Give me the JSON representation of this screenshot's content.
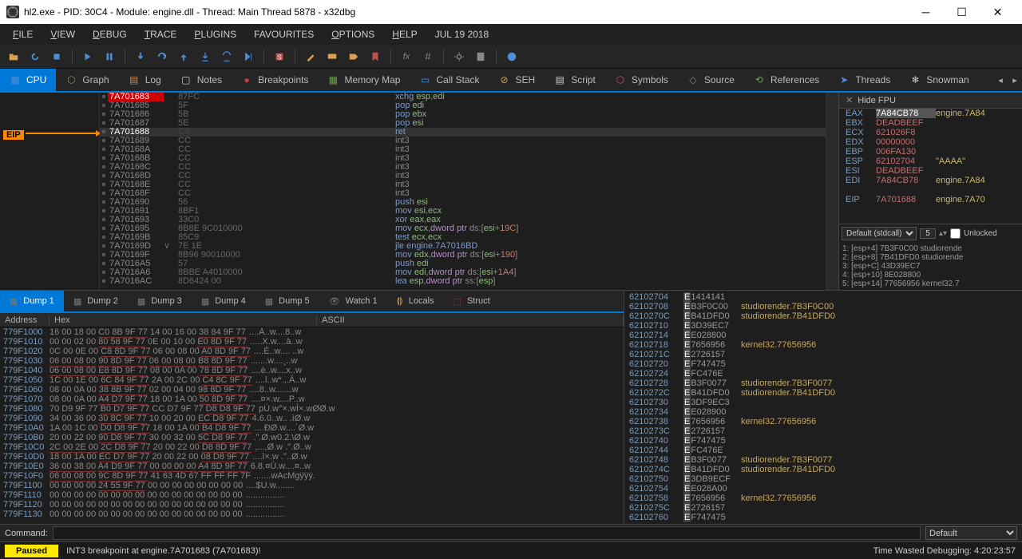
{
  "window": {
    "title": "hl2.exe - PID: 30C4 - Module: engine.dll - Thread: Main Thread 5878 - x32dbg"
  },
  "menu": [
    "FILE",
    "VIEW",
    "DEBUG",
    "TRACE",
    "PLUGINS",
    "FAVOURITES",
    "OPTIONS",
    "HELP",
    "JUL 19 2018"
  ],
  "menu_ul": [
    "F",
    "V",
    "D",
    "T",
    "P",
    "",
    "O",
    "H",
    ""
  ],
  "tabs": [
    "CPU",
    "Graph",
    "Log",
    "Notes",
    "Breakpoints",
    "Memory Map",
    "Call Stack",
    "SEH",
    "Script",
    "Symbols",
    "Source",
    "References",
    "Threads",
    "Snowman"
  ],
  "tab_icons": [
    "cpu",
    "graph",
    "log",
    "notes",
    "bp",
    "mem",
    "stack",
    "seh",
    "script",
    "sym",
    "src",
    "ref",
    "thr",
    "snow"
  ],
  "active_tab": 0,
  "disasm": [
    {
      "dot": "●",
      "addr": "7A701683",
      "hl": true,
      "bytes": "87FC",
      "asm": "<span class=mn>xchg</span> <span class=reg>esp</span>,<span class=reg>edi</span>"
    },
    {
      "dot": "●",
      "addr": "7A701685",
      "bytes": "5F",
      "asm": "<span class=mn>pop</span> <span class=reg>edi</span>"
    },
    {
      "dot": "●",
      "addr": "7A701686",
      "bytes": "5B",
      "asm": "<span class=mn>pop</span> <span class=reg>ebx</span>"
    },
    {
      "dot": "●",
      "addr": "7A701687",
      "bytes": "5E",
      "asm": "<span class=mn>pop</span> <span class=reg>esi</span>"
    },
    {
      "dot": "●",
      "addr": "7A701688",
      "cur": true,
      "bytes": "C3",
      "asm": "<span class=mn>ret</span>"
    },
    {
      "dot": "●",
      "addr": "7A701689",
      "bytes": "CC",
      "asm": "int3"
    },
    {
      "dot": "●",
      "addr": "7A70168A",
      "bytes": "CC",
      "asm": "int3"
    },
    {
      "dot": "●",
      "addr": "7A70168B",
      "bytes": "CC",
      "asm": "int3"
    },
    {
      "dot": "●",
      "addr": "7A70168C",
      "bytes": "CC",
      "asm": "int3"
    },
    {
      "dot": "●",
      "addr": "7A70168D",
      "bytes": "CC",
      "asm": "int3"
    },
    {
      "dot": "●",
      "addr": "7A70168E",
      "bytes": "CC",
      "asm": "int3"
    },
    {
      "dot": "●",
      "addr": "7A70168F",
      "bytes": "CC",
      "asm": "int3"
    },
    {
      "dot": "●",
      "addr": "7A701690",
      "bytes": "56",
      "asm": "<span class=mn>push</span> <span class=reg>esi</span>"
    },
    {
      "dot": "●",
      "addr": "7A701691",
      "bytes": "8BF1",
      "asm": "<span class=mn>mov</span> <span class=reg>esi</span>,<span class=reg>ecx</span>"
    },
    {
      "dot": "●",
      "addr": "7A701693",
      "bytes": "33C0",
      "asm": "<span class=mn>xor</span> <span class=reg>eax</span>,<span class=reg>eax</span>"
    },
    {
      "dot": "●",
      "addr": "7A701695",
      "bytes": "8B8E 9C010000",
      "asm": "<span class=mn>mov</span> <span class=reg>ecx</span>,<span class=kw>dword ptr</span> ds:[<span class=reg>esi</span>+<span class=num>19C</span>]"
    },
    {
      "dot": "●",
      "addr": "7A70169B",
      "bytes": "85C9",
      "asm": "<span class=mn>test</span> <span class=reg>ecx</span>,<span class=reg>ecx</span>"
    },
    {
      "dot": "●",
      "addr": "7A70169D",
      "jmp": "∨",
      "bytes": "7E 1E",
      "asm": "<span class=mn>jle</span> <span class=lbl>engine.7A7016BD</span>"
    },
    {
      "dot": "●",
      "addr": "7A70169F",
      "bytes": "8B96 90010000",
      "asm": "<span class=mn>mov</span> <span class=reg>edx</span>,<span class=kw>dword ptr</span> ds:[<span class=reg>esi</span>+<span class=num>190</span>]"
    },
    {
      "dot": "●",
      "addr": "7A7016A5",
      "bytes": "57",
      "asm": "<span class=mn>push</span> <span class=reg>edi</span>"
    },
    {
      "dot": "●",
      "addr": "7A7016A6",
      "bytes": "8BBE A4010000",
      "asm": "<span class=mn>mov</span> <span class=reg>edi</span>,<span class=kw>dword ptr</span> ds:[<span class=reg>esi</span>+<span class=num>1A4</span>]"
    },
    {
      "dot": "●",
      "addr": "7A7016AC",
      "bytes": "8D6424 00",
      "asm": "<span class=mn>lea</span> <span class=reg>esp</span>,<span class=kw>dword ptr</span> ss:[<span class=reg>esp</span>]"
    }
  ],
  "eip_marker": "EIP",
  "registers": {
    "title": "Hide FPU",
    "rows": [
      {
        "n": "EAX",
        "v": "7A84CB78",
        "sel": true,
        "c": "engine.7A84"
      },
      {
        "n": "EBX",
        "v": "DEADBEEF",
        "c": ""
      },
      {
        "n": "ECX",
        "v": "621026F8",
        "c": ""
      },
      {
        "n": "EDX",
        "v": "00000000",
        "c": ""
      },
      {
        "n": "EBP",
        "v": "006FA130",
        "c": ""
      },
      {
        "n": "ESP",
        "v": "62102704",
        "c": "\"AAAA\""
      },
      {
        "n": "ESI",
        "v": "DEADBEEF",
        "c": ""
      },
      {
        "n": "EDI",
        "v": "7A84CB78",
        "c": "engine.7A84"
      },
      {
        "n": "",
        "v": "",
        "c": ""
      },
      {
        "n": "EIP",
        "v": "7A701688",
        "c": "engine.7A70"
      }
    ],
    "calling_conv": "Default (stdcall)",
    "spin": "5",
    "unlocked": "Unlocked",
    "stackargs": [
      "1: [esp+4] 7B3F0C00 studiorende",
      "2: [esp+8] 7B41DFD0 studiorende",
      "3: [esp+C] 43D39EC7",
      "4: [esp+10] 8E028800",
      "5: [esp+14] 77656956 kernel32.7"
    ]
  },
  "dump_tabs": [
    "Dump 1",
    "Dump 2",
    "Dump 3",
    "Dump 4",
    "Dump 5",
    "Watch 1",
    "Locals",
    "Struct"
  ],
  "active_dump": 0,
  "dump_headers": [
    "Address",
    "Hex",
    "ASCII"
  ],
  "dump": [
    {
      "a": "779F1000",
      "h": "16 00 18 00 <span class=grp>C0 8B 9F 77</span> 14 00 16 00 <span class=grp>38 84 9F 77</span>",
      "s": "....À..w....8..w"
    },
    {
      "a": "779F1010",
      "h": "00 00 02 00 <span class=grp>80 58 9F 77</span> 0E 00 10 00 <span class=grp>E0 8D 9F 77</span>",
      "s": ".....X.w....à..w"
    },
    {
      "a": "779F1020",
      "h": "0C 00 0E 00 <span class=grp>C8 8D 9F 77</span> 06 00 08 00 <span class=grp>A0 8D 9F 77</span>",
      "s": "....È..w.... ..w"
    },
    {
      "a": "779F1030",
      "h": "<span class=grp>06 00 08 00</span> <span class=grp>90 8D 9F 77</span> <span class=grp>06 00 08 00</span> <span class=grp>B8 8D 9F 77</span>",
      "s": ".......w....¸..w"
    },
    {
      "a": "779F1040",
      "h": "<span class=grp>06 00 08 00</span> <span class=grp>E8 8D 9F 77</span> 08 00 0A 00 <span class=grp>78 8D 9F 77</span>",
      "s": "....è..w....x..w"
    },
    {
      "a": "779F1050",
      "h": "1C 00 1E 00 <span class=grp>6C 84 9F 77</span> 2A 00 2C 00 <span class=grp>C4 8C 9F 77</span>",
      "s": "....l..w*.,.Ä..w"
    },
    {
      "a": "779F1060",
      "h": "08 00 0A 00 <span class=grp>38 8B 9F 77</span> 02 00 04 00 <span class=grp>98 8D 9F 77</span>",
      "s": "....8..w.......w"
    },
    {
      "a": "779F1070",
      "h": "08 00 0A 00 <span class=grp>A4 D7 9F 77</span> 18 00 1A 00 <span class=grp>50 8D 9F 77</span>",
      "s": "....¤×.w....P..w"
    },
    {
      "a": "779F1080",
      "h": "70 D9 9F 77 <span class=grp>B0 D7 9F 77</span> CC D7 9F 77 <span class=grp>D8 D8 9F 77</span>",
      "s": "pÙ.w°×.wÌ×.wØØ.w"
    },
    {
      "a": "779F1090",
      "h": "34 00 36 00 <span class=grp>30 8C 9F 77</span> 10 00 20 00 <span class=grp>EC D8 9F 77</span>",
      "s": "4.6.0..w.. .ìØ.w"
    },
    {
      "a": "779F10A0",
      "h": "1A 00 1C 00 <span class=grp>D0 D8 9F 77</span> 18 00 1A 00 <span class=grp>B4 D8 9F 77</span>",
      "s": "....ÐØ.w....´Ø.w"
    },
    {
      "a": "779F10B0",
      "h": "20 00 22 00 <span class=grp>90 D8 9F 77</span> 30 00 32 00 <span class=grp>5C D8 9F 77</span>",
      "s": " .\".Ø.w0.2.\\Ø.w"
    },
    {
      "a": "779F10C0",
      "h": "<span class=grp>2C 00 2E 00</span> <span class=grp>2C D8 9F 77</span> 20 00 22 00 <span class=grp>D8 8D 9F 77</span>",
      "s": ",...,Ø.w .\".Ø..w"
    },
    {
      "a": "779F10D0",
      "h": "18 00 1A 00 <span class=grp>EC D7 9F 77</span> 20 00 22 00 <span class=grp>08 D8 9F 77</span>",
      "s": "....ì×.w .\"..Ø.w"
    },
    {
      "a": "779F10E0",
      "h": "<span class=grp>36 00 38 00</span> <span class=grp>A4 D9 9F 77</span> <span class=grp>00 00 00 00</span> <span class=grp>A4 8D 9F 77</span>",
      "s": "6.8.¤Ù.w....¤..w"
    },
    {
      "a": "779F10F0",
      "h": "<span class=grp>06 00 08 00</span> <span class=grp>9C 8D 9F 77</span> 41 63 4D 67 FF FF FF 7F",
      "s": ".......wAcMgÿÿÿ."
    },
    {
      "a": "779F1100",
      "h": "00 00 00 00 <span class=grp>24 55 9F 77</span> 00 00 00 00 00 00 00 00",
      "s": "....$U.w........"
    },
    {
      "a": "779F1110",
      "h": "00 00 00 00 00 00 00 00 00 00 00 00 00 00 00 00",
      "s": "................"
    },
    {
      "a": "779F1120",
      "h": "00 00 00 00 00 00 00 00 00 00 00 00 00 00 00 00",
      "s": "................"
    },
    {
      "a": "779F1130",
      "h": "00 00 00 00 00 00 00 00 00 00 00 00 00 00 00 00",
      "s": "................"
    }
  ],
  "stack": [
    {
      "a": "62102704",
      "v": "41414141",
      "c": ""
    },
    {
      "a": "62102708",
      "v": "7B3F0C00",
      "c": "studiorender.7B3F0C00"
    },
    {
      "a": "6210270C",
      "v": "7B41DFD0",
      "c": "studiorender.7B41DFD0"
    },
    {
      "a": "62102710",
      "v": "43D39EC7",
      "c": ""
    },
    {
      "a": "62102714",
      "v": "8E028800",
      "c": ""
    },
    {
      "a": "62102718",
      "v": "77656956",
      "c": "kernel32.77656956"
    },
    {
      "a": "6210271C",
      "v": "42726157",
      "c": ""
    },
    {
      "a": "62102720",
      "v": "6F747475",
      "c": ""
    },
    {
      "a": "62102724",
      "v": "6FC476E",
      "c": ""
    },
    {
      "a": "62102728",
      "v": "7B3F0077",
      "c": "studiorender.7B3F0077"
    },
    {
      "a": "6210272C",
      "v": "7B41DFD0",
      "c": "studiorender.7B41DFD0"
    },
    {
      "a": "62102730",
      "v": "43DF9EC3",
      "c": ""
    },
    {
      "a": "62102734",
      "v": "8E028900",
      "c": ""
    },
    {
      "a": "62102738",
      "v": "77656956",
      "c": "kernel32.77656956"
    },
    {
      "a": "6210273C",
      "v": "42726157",
      "c": ""
    },
    {
      "a": "62102740",
      "v": "6F747475",
      "c": ""
    },
    {
      "a": "62102744",
      "v": "6FC476E",
      "c": ""
    },
    {
      "a": "62102748",
      "v": "7B3F0077",
      "c": "studiorender.7B3F0077"
    },
    {
      "a": "6210274C",
      "v": "7B41DFD0",
      "c": "studiorender.7B41DFD0"
    },
    {
      "a": "62102750",
      "v": "43DB9ECF",
      "c": ""
    },
    {
      "a": "62102754",
      "v": "8E028A00",
      "c": ""
    },
    {
      "a": "62102758",
      "v": "77656956",
      "c": "kernel32.77656956"
    },
    {
      "a": "6210275C",
      "v": "42726157",
      "c": ""
    },
    {
      "a": "62102760",
      "v": "6F747475",
      "c": ""
    }
  ],
  "command": {
    "label": "Command:",
    "value": "",
    "mode": "Default"
  },
  "status": {
    "state": "Paused",
    "msg": "INT3 breakpoint at engine.7A701683 (7A701683)!",
    "time": "Time Wasted Debugging: 4:20:23:57"
  }
}
